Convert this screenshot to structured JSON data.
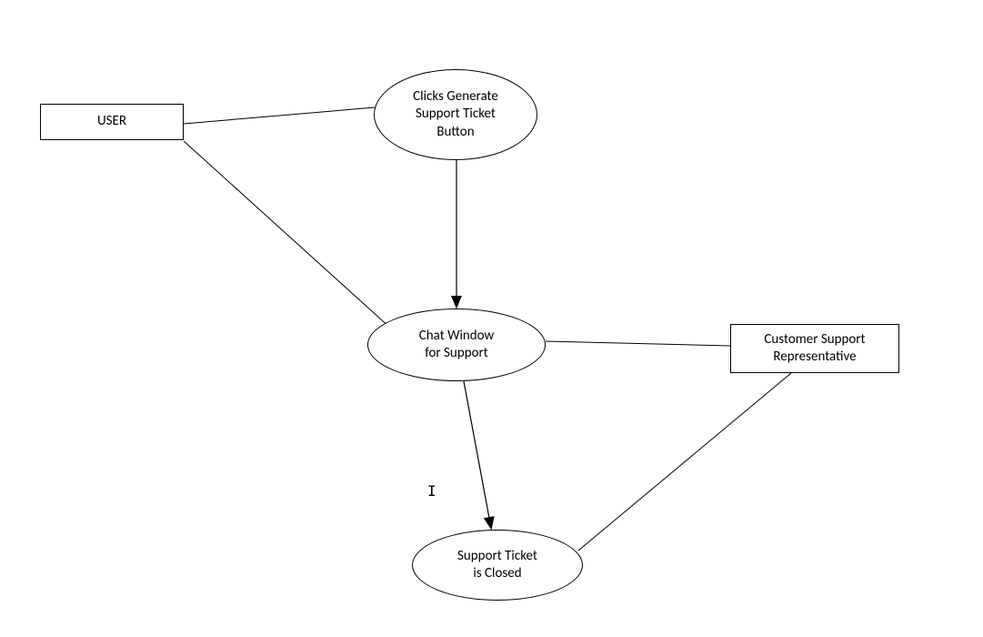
{
  "nodes": {
    "user": {
      "label": "USER"
    },
    "clicks_generate": {
      "label_l1": "Clicks Generate",
      "label_l2": "Support Ticket",
      "label_l3": "Button"
    },
    "chat_window": {
      "label_l1": "Chat Window",
      "label_l2": "for Support"
    },
    "csr": {
      "label_l1": "Customer Support",
      "label_l2": "Representative"
    },
    "ticket_closed": {
      "label_l1": "Support Ticket",
      "label_l2": "is Closed"
    }
  },
  "chart_data": {
    "type": "diagram",
    "title": "",
    "nodes": [
      {
        "id": "user",
        "shape": "rect",
        "label": "USER"
      },
      {
        "id": "clicks_generate",
        "shape": "ellipse",
        "label": "Clicks Generate Support Ticket Button"
      },
      {
        "id": "chat_window",
        "shape": "ellipse",
        "label": "Chat Window for Support"
      },
      {
        "id": "csr",
        "shape": "rect",
        "label": "Customer Support Representative"
      },
      {
        "id": "ticket_closed",
        "shape": "ellipse",
        "label": "Support Ticket is Closed"
      }
    ],
    "edges": [
      {
        "from": "user",
        "to": "clicks_generate",
        "arrow": false
      },
      {
        "from": "user",
        "to": "chat_window",
        "arrow": false
      },
      {
        "from": "clicks_generate",
        "to": "chat_window",
        "arrow": true
      },
      {
        "from": "chat_window",
        "to": "csr",
        "arrow": false
      },
      {
        "from": "chat_window",
        "to": "ticket_closed",
        "arrow": true
      },
      {
        "from": "csr",
        "to": "ticket_closed",
        "arrow": false
      }
    ]
  }
}
